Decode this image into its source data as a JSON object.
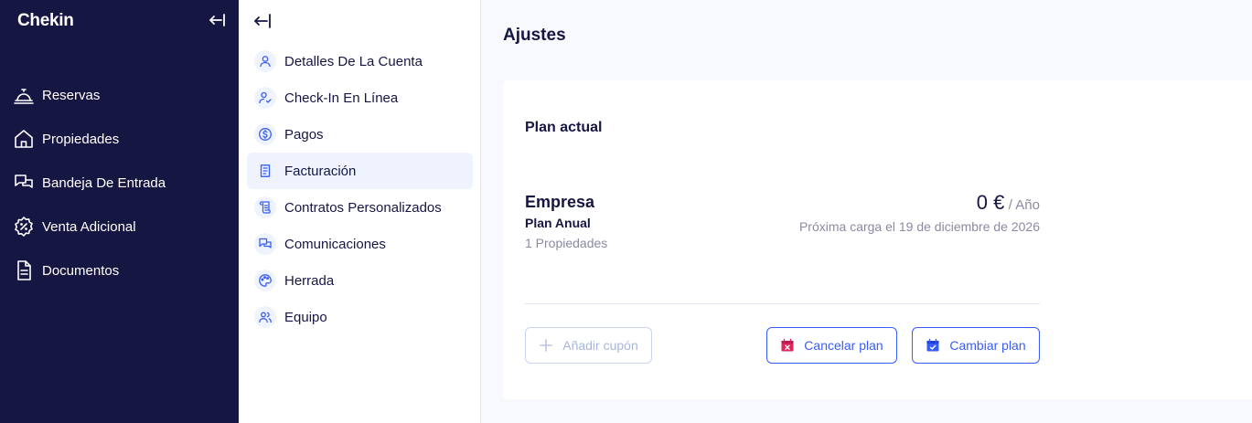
{
  "app": {
    "logo": "Chekin"
  },
  "nav": {
    "items": [
      {
        "label": "Reservas",
        "icon": "concierge-bell-icon"
      },
      {
        "label": "Propiedades",
        "icon": "house-icon"
      },
      {
        "label": "Bandeja De Entrada",
        "icon": "inbox-chat-icon"
      },
      {
        "label": "Venta Adicional",
        "icon": "discount-badge-icon"
      },
      {
        "label": "Documentos",
        "icon": "document-icon"
      }
    ]
  },
  "submenu": {
    "active_index": 3,
    "items": [
      {
        "label": "Detalles De La Cuenta",
        "icon": "user-icon"
      },
      {
        "label": "Check-In En Línea",
        "icon": "user-check-icon"
      },
      {
        "label": "Pagos",
        "icon": "dollar-icon"
      },
      {
        "label": "Facturación",
        "icon": "invoice-icon"
      },
      {
        "label": "Contratos Personalizados",
        "icon": "contract-scroll-icon"
      },
      {
        "label": "Comunicaciones",
        "icon": "chat-icon"
      },
      {
        "label": "Herrada",
        "icon": "palette-icon"
      },
      {
        "label": "Equipo",
        "icon": "team-icon"
      }
    ]
  },
  "main": {
    "title": "Ajustes",
    "card": {
      "title": "Plan actual",
      "plan_name": "Empresa",
      "plan_type": "Plan Anual",
      "properties": "1 Propiedades",
      "price_amount": "0 €",
      "price_period": "/ Año",
      "next_charge": "Próxima carga el 19 de diciembre de 2026",
      "coupon_label": "Añadir cupón",
      "cancel_label": "Cancelar plan",
      "change_label": "Cambiar plan"
    }
  },
  "colors": {
    "sidebar_bg": "#161643",
    "accent": "#385cf8",
    "danger_icon": "#e0245e",
    "active_bg": "#eef3fd"
  }
}
